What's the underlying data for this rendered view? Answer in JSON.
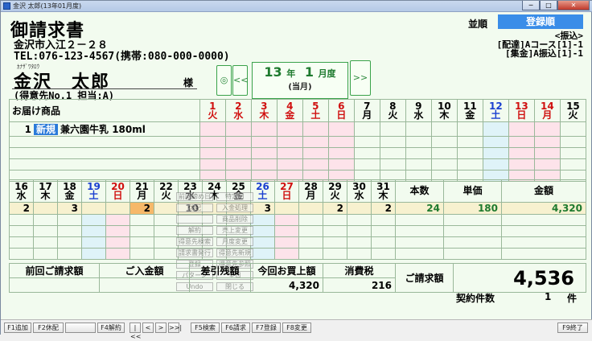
{
  "window": {
    "title": "金沢 太郎(13年01月度)",
    "min": "─",
    "max": "□",
    "close": "✕"
  },
  "doc": {
    "title": "御請求書",
    "address": "金沢市入江２－２８",
    "tel": "TEL:076-123-4567(携帯:080-000-0000)",
    "kana": "ｶﾅｻﾞﾜﾀﾛｳ",
    "name": "金沢　太郎",
    "honorific": "様",
    "customer_info": "(得意先No.1 担当:A)"
  },
  "nav": {
    "home_icon": "target-icon",
    "prev": "<<",
    "next": ">>",
    "year_num": "13",
    "year_label": "年",
    "month_num": "1",
    "month_label": "月度",
    "current": "(当月)"
  },
  "sort": {
    "label": "並順",
    "value": "登録順"
  },
  "right_info": {
    "line1": "<振込>",
    "line2": "[配達]Aコース[1]-1",
    "line3": "[集金]A振込[1]-1"
  },
  "product_header": "お届け商品",
  "days_top": [
    {
      "d": "1",
      "w": "火",
      "c": "red"
    },
    {
      "d": "2",
      "w": "水",
      "c": "red"
    },
    {
      "d": "3",
      "w": "木",
      "c": "red"
    },
    {
      "d": "4",
      "w": "金",
      "c": "red"
    },
    {
      "d": "5",
      "w": "土",
      "c": "red"
    },
    {
      "d": "6",
      "w": "日",
      "c": "red"
    },
    {
      "d": "7",
      "w": "月",
      "c": ""
    },
    {
      "d": "8",
      "w": "火",
      "c": ""
    },
    {
      "d": "9",
      "w": "水",
      "c": ""
    },
    {
      "d": "10",
      "w": "木",
      "c": ""
    },
    {
      "d": "11",
      "w": "金",
      "c": ""
    },
    {
      "d": "12",
      "w": "土",
      "c": "blue"
    },
    {
      "d": "13",
      "w": "日",
      "c": "red"
    },
    {
      "d": "14",
      "w": "月",
      "c": "red"
    },
    {
      "d": "15",
      "w": "火",
      "c": ""
    }
  ],
  "days_bottom": [
    {
      "d": "16",
      "w": "水",
      "c": ""
    },
    {
      "d": "17",
      "w": "木",
      "c": ""
    },
    {
      "d": "18",
      "w": "金",
      "c": ""
    },
    {
      "d": "19",
      "w": "土",
      "c": "blue"
    },
    {
      "d": "20",
      "w": "日",
      "c": "red"
    },
    {
      "d": "21",
      "w": "月",
      "c": ""
    },
    {
      "d": "22",
      "w": "火",
      "c": ""
    },
    {
      "d": "23",
      "w": "水",
      "c": ""
    },
    {
      "d": "24",
      "w": "木",
      "c": ""
    },
    {
      "d": "25",
      "w": "金",
      "c": ""
    },
    {
      "d": "26",
      "w": "土",
      "c": "blue"
    },
    {
      "d": "27",
      "w": "日",
      "c": "red"
    },
    {
      "d": "28",
      "w": "月",
      "c": ""
    },
    {
      "d": "29",
      "w": "火",
      "c": ""
    },
    {
      "d": "30",
      "w": "水",
      "c": ""
    },
    {
      "d": "31",
      "w": "木",
      "c": ""
    }
  ],
  "product_row": {
    "index": "1",
    "new_tag": "新規",
    "name": "兼六園牛乳 180ml"
  },
  "bottom_row1": [
    "2",
    "",
    "3",
    "",
    "",
    "2",
    "",
    "10",
    "",
    "",
    "3",
    "",
    "",
    "2",
    "",
    "2"
  ],
  "summary_headers": {
    "count": "本数",
    "unit": "単価",
    "amount": "金額"
  },
  "summary_row1": {
    "count": "24",
    "unit": "180",
    "amount": "4,320"
  },
  "popup": [
    "前回締め日",
    "特定日",
    "休配",
    "入金処理",
    "",
    "商品削除",
    "解約",
    "売上変更",
    "得意先検索",
    "月度変更",
    "請求書発行",
    "得意先新規",
    "登録",
    "得意先参照",
    "パターン",
    "全日",
    "Undo",
    "閉じる"
  ],
  "totals": {
    "prev_label": "前回ご請求額",
    "paid_label": "ご入金額",
    "balance_label": "差引残額",
    "purchase_label": "今回お買上額",
    "purchase_value": "4,320",
    "tax_label": "消費税",
    "tax_value": "216",
    "invoice_label": "ご請求額",
    "invoice_value": "4,536",
    "contract_label": "契約件数",
    "contract_value": "1",
    "contract_unit": "件"
  },
  "fkeys": [
    "F1追加",
    "F2休配",
    "",
    "F4解約",
    "|<<",
    "<",
    ">",
    ">>|",
    "F5検索",
    "F6請求",
    "F7登録",
    "F8変更",
    "F9終了"
  ]
}
